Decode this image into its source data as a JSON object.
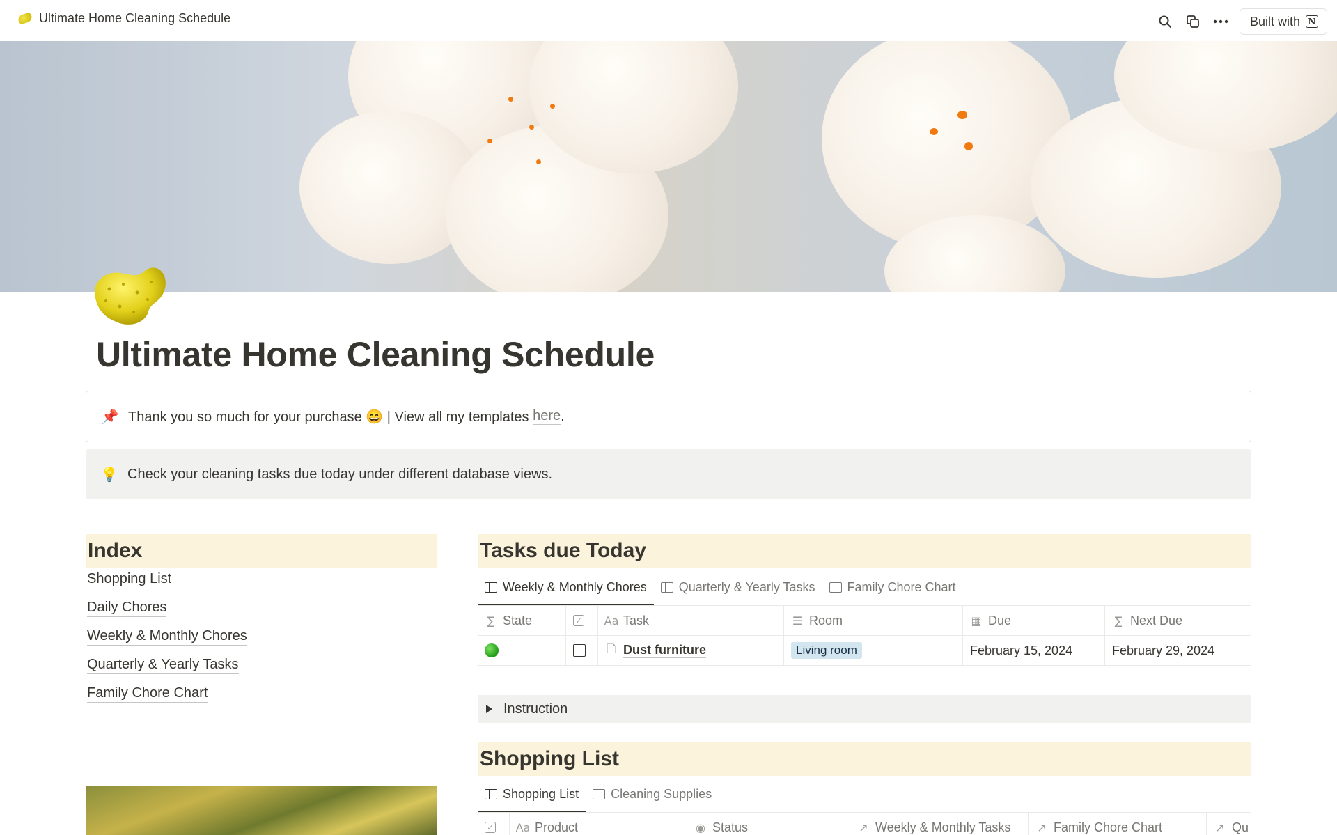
{
  "topbar": {
    "page_title": "Ultimate Home Cleaning Schedule",
    "built_with_label": "Built with",
    "icons": [
      "search-icon",
      "duplicate-icon",
      "more-icon",
      "notion-logo-icon"
    ]
  },
  "page": {
    "title": "Ultimate Home Cleaning Schedule",
    "icon": "sponge-icon"
  },
  "callouts": {
    "purchase": {
      "emoji": "📌",
      "text_before": "Thank you so much for your purchase 😄 | View all my templates ",
      "link_text": "here",
      "text_after": "."
    },
    "tip": {
      "emoji": "💡",
      "text": "Check your cleaning tasks due today under different database views."
    }
  },
  "index": {
    "heading": "Index",
    "links": [
      "Shopping List",
      "Daily Chores",
      "Weekly & Monthly Chores",
      "Quarterly & Yearly Tasks",
      "Family Chore Chart"
    ]
  },
  "tasks_due": {
    "heading": "Tasks due Today",
    "tabs": [
      "Weekly & Monthly Chores",
      "Quarterly & Yearly Tasks",
      "Family Chore Chart"
    ],
    "columns": [
      "State",
      "",
      "Task",
      "Room",
      "Due",
      "Next Due"
    ],
    "rows": [
      {
        "state": "green-dot",
        "checked": false,
        "task": "Dust furniture",
        "room": "Living room",
        "due": "February 15, 2024",
        "next_due": "February 29, 2024"
      }
    ],
    "toggle_label": "Instruction"
  },
  "shopping": {
    "heading": "Shopping List",
    "tabs": [
      "Shopping List",
      "Cleaning Supplies"
    ],
    "columns": [
      "",
      "Product",
      "Status",
      "Weekly & Monthly Tasks",
      "Family Chore Chart",
      "Qu"
    ]
  },
  "colors": {
    "heading_bg": "#fbf3db",
    "callout_bg": "#f1f1ef",
    "room_tag_bg": "#d3e5ef",
    "text": "#37352f"
  }
}
